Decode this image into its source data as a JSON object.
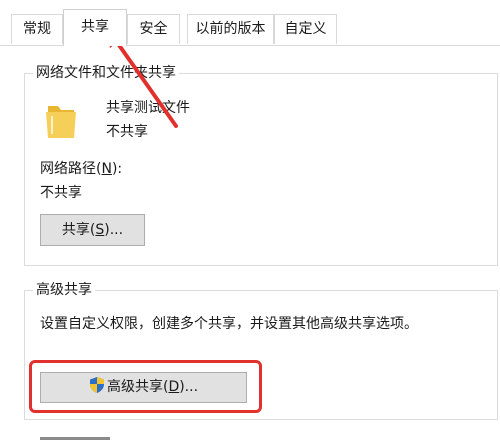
{
  "tabs": [
    {
      "label": "常规"
    },
    {
      "label": "共享"
    },
    {
      "label": "安全"
    },
    {
      "label": "以前的版本"
    },
    {
      "label": "自定义"
    }
  ],
  "network_sharing": {
    "title": "网络文件和文件夹共享",
    "item_name": "共享测试文件",
    "item_status": "不共享",
    "path_label": "网络路径",
    "path_key": "N",
    "path_value": "不共享",
    "share_button": {
      "label": "共享",
      "key": "S"
    }
  },
  "advanced_sharing": {
    "title": "高级共享",
    "description": "设置自定义权限，创建多个共享，并设置其他高级共享选项。",
    "button": {
      "label": "高级共享",
      "key": "D"
    }
  },
  "colors": {
    "annotation": "#e0312c",
    "folder": "#f3c64d",
    "shield_blue": "#2b6fc7",
    "shield_yellow": "#f4c430"
  },
  "icons": {
    "folder": "folder-icon",
    "shield": "uac-shield-icon",
    "arrow": "red-arrow-annotation"
  }
}
